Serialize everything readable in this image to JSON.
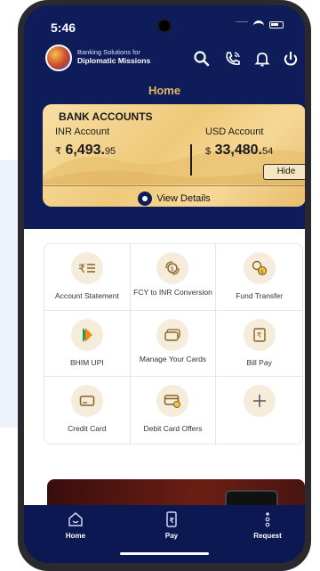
{
  "status_bar": {
    "time": "5:46"
  },
  "header": {
    "brand_line1": "Banking Solutions for",
    "brand_line2": "Diplomatic Missions",
    "icons": [
      "search-icon",
      "phone-call-icon",
      "bell-icon",
      "power-icon"
    ]
  },
  "page_title": "Home",
  "accounts_card": {
    "title": "BANK ACCOUNTS",
    "inr": {
      "label": "INR Account",
      "currency": "₹",
      "whole": "6,493.",
      "decimals": "95"
    },
    "usd": {
      "label": "USD Account",
      "currency": "$",
      "whole": "33,480.",
      "decimals": "54"
    },
    "hide_label": "Hide",
    "view_details_label": "View Details"
  },
  "tiles": [
    {
      "label": "Account Statement",
      "icon": "rupee-list-icon"
    },
    {
      "label": "FCY to INR Conversion",
      "icon": "currency-exchange-icon"
    },
    {
      "label": "Fund Transfer",
      "icon": "fund-transfer-icon"
    },
    {
      "label": "BHIM UPI",
      "icon": "bhim-upi-icon"
    },
    {
      "label": "Manage Your Cards",
      "icon": "cards-icon"
    },
    {
      "label": "Bill Pay",
      "icon": "bill-icon"
    },
    {
      "label": "Credit Card",
      "icon": "credit-card-icon"
    },
    {
      "label": "Debit Card Offers",
      "icon": "debit-card-offer-icon"
    },
    {
      "label": "",
      "icon": "plus-icon"
    }
  ],
  "bottom_nav": [
    {
      "label": "Home",
      "icon": "home-icon"
    },
    {
      "label": "Pay",
      "icon": "pay-icon"
    },
    {
      "label": "Request",
      "icon": "request-icon"
    }
  ],
  "colors": {
    "navy": "#0e1c5a",
    "gold_text": "#e4b562",
    "card_gold": "#efc97a"
  }
}
